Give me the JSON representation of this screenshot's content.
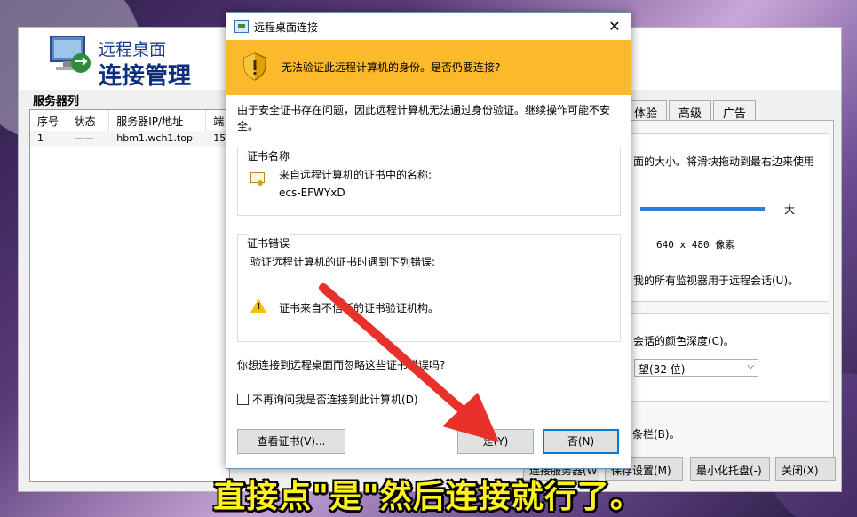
{
  "manager": {
    "title_line1": "远程桌面",
    "title_line2": "连接管理",
    "list_label": "服务器列",
    "columns": [
      "序号",
      "状态",
      "服务器IP/地址",
      "端"
    ],
    "rows": [
      {
        "index": "1",
        "status": "——",
        "server": "hbm1.wch1.top",
        "port": "15"
      }
    ],
    "tabs": [
      "体验",
      "高级",
      "广告"
    ],
    "panel_text": {
      "size_desc": "面的大小。将滑块拖动到最右边来使用",
      "size_large": "大",
      "resolution": "640 x 480 像素",
      "monitors": "我的所有监视器用于远程会话(U)。",
      "color_depth": "会话的颜色深度(C)。",
      "color_value": "望(32 位)",
      "bar": "条栏(B)。"
    },
    "buttons": {
      "connect": "连接服务器(W)",
      "save": "保存设置(M)",
      "minimize": "最小化托盘(-)",
      "close": "关闭(X)"
    }
  },
  "dialog": {
    "title": "远程桌面连接",
    "close_glyph": "✕",
    "warning": "无法验证此远程计算机的身份。是否仍要连接?",
    "intro": "由于安全证书存在问题，因此远程计算机无法通过身份验证。继续操作可能不安全。",
    "cert_group_title": "证书名称",
    "cert_name_label": "来自远程计算机的证书中的名称:",
    "cert_name": "ecs-EFWYxD",
    "error_group_title": "证书错误",
    "error_intro": "验证远程计算机的证书时遇到下列错误:",
    "error_item": "证书来自不信任的证书验证机构。",
    "question": "你想连接到远程桌面而忽略这些证书错误吗?",
    "checkbox_label": "不再询问我是否连接到此计算机(D)",
    "view_cert_button": "查看证书(V)...",
    "yes_button": "是(Y)",
    "no_button": "否(N)"
  },
  "caption": "直接点\"是\"然后连接就行了。",
  "colors": {
    "warning_band": "#fcb92b",
    "arrow": "#e8312a",
    "caption": "#fff21c"
  }
}
